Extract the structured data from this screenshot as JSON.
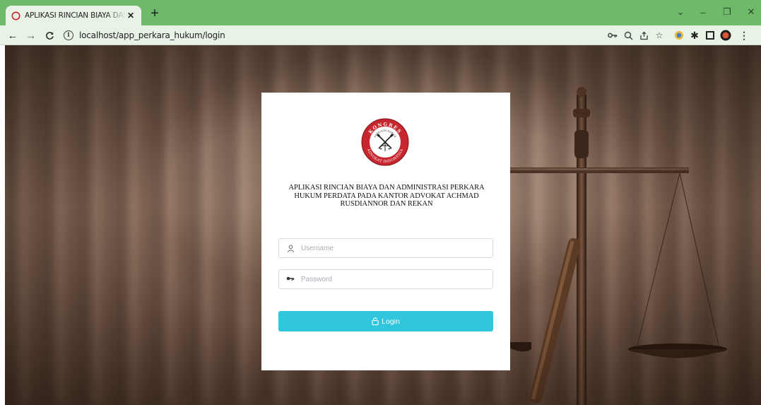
{
  "browser": {
    "tab_title": "APLIKASI RINCIAN BIAYA DAN ADMINISTRASI",
    "new_tab_symbol": "+",
    "url": "localhost/app_perkara_hukum/login",
    "theme_color": "#6fb96b",
    "toolbar_icons": [
      "key-icon",
      "zoom-icon",
      "share-icon",
      "star-icon",
      "extension-icon",
      "puzzle-icon",
      "sidepanel-icon",
      "profile-icon",
      "menu-icon"
    ]
  },
  "login": {
    "logo_top_text": "KONGRES",
    "logo_inner_text": "OFFICIUM NOBILE",
    "logo_bottom_text": "ADVOKAT INDONESIA",
    "title": "APLIKASI RINCIAN BIAYA DAN ADMINISTRASI PERKARA HUKUM PERDATA PADA KANTOR ADVOKAT ACHMAD RUSDIANNOR DAN REKAN",
    "username_placeholder": "Username",
    "password_placeholder": "Password",
    "login_label": "Login",
    "button_color": "#2fc6de"
  }
}
